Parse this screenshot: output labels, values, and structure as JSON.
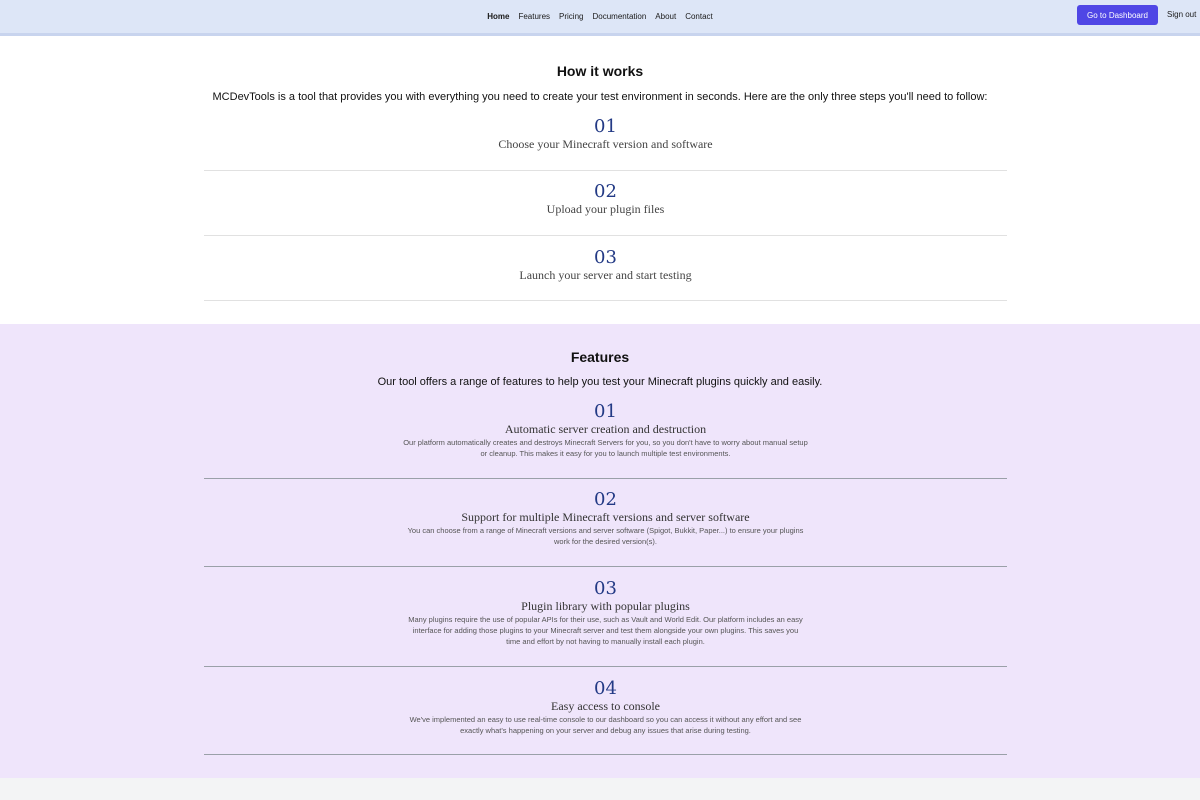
{
  "nav": {
    "links": [
      "Home",
      "Features",
      "Pricing",
      "Documentation",
      "About",
      "Contact"
    ],
    "dashboard_label": "Go to Dashboard",
    "signout_label": "Sign out"
  },
  "how": {
    "title": "How it works",
    "intro": "MCDevTools is a tool that provides you with everything you need to create your test environment in seconds. Here are the only three steps you'll need to follow:",
    "steps": [
      {
        "num": "01",
        "text": "Choose your Minecraft version and software"
      },
      {
        "num": "02",
        "text": "Upload your plugin files"
      },
      {
        "num": "03",
        "text": "Launch your server and start testing"
      }
    ]
  },
  "features": {
    "title": "Features",
    "intro": "Our tool offers a range of features to help you test your Minecraft plugins quickly and easily.",
    "items": [
      {
        "num": "01",
        "title": "Automatic server creation and destruction",
        "desc": "Our platform automatically creates and destroys Minecraft Servers for you, so you don't have to worry about manual setup or cleanup. This makes it easy for you to launch multiple test environments."
      },
      {
        "num": "02",
        "title": "Support for multiple Minecraft versions and server software",
        "desc": "You can choose from a range of Minecraft versions and server software (Spigot, Bukkit, Paper...) to ensure your plugins work for the desired version(s)."
      },
      {
        "num": "03",
        "title": "Plugin library with popular plugins",
        "desc": "Many plugins require the use of popular APIs for their use, such as Vault and World Edit. Our platform includes an easy interface for adding those plugins to your Minecraft server and test them alongside your own plugins. This saves you time and effort by not having to manually install each plugin."
      },
      {
        "num": "04",
        "title": "Easy access to console",
        "desc": "We've implemented an easy to use real-time console to our dashboard so you can access it without any effort and see exactly what's happening on your server and debug any issues that arise during testing."
      }
    ]
  }
}
